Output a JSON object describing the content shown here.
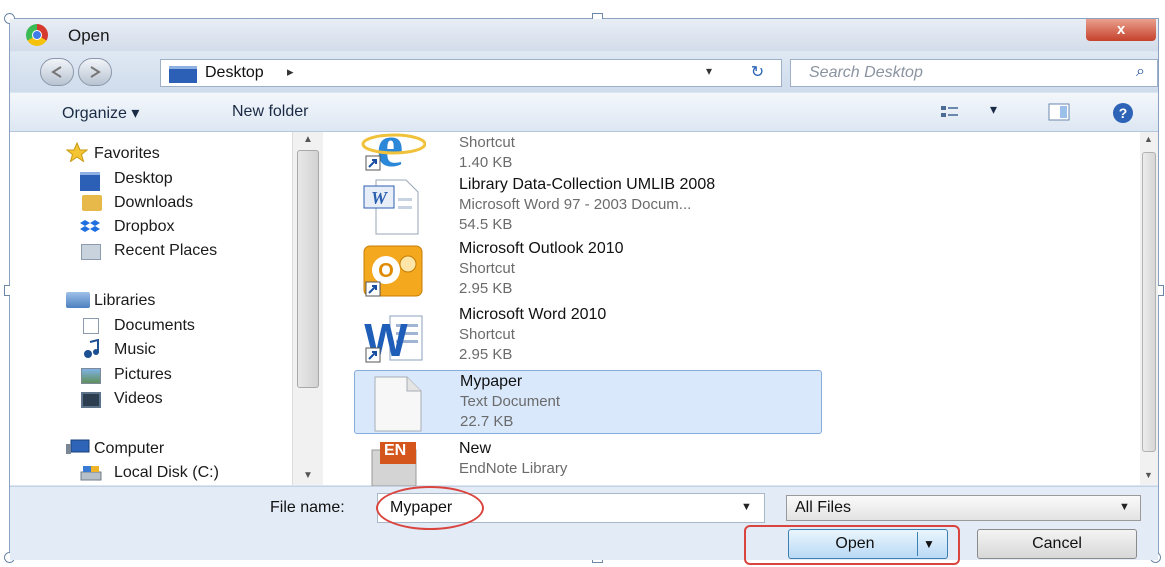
{
  "window": {
    "title": "Open",
    "close_glyph": "x"
  },
  "nav": {
    "back_icon": "back-arrow-icon",
    "forward_icon": "forward-arrow-icon",
    "address_label": "Desktop",
    "address_arrow": "▸",
    "address_dropdown": "▾",
    "refresh_glyph": "↻",
    "search_placeholder": "Search Desktop",
    "search_icon": "⌕"
  },
  "toolbar": {
    "organize": "Organize ▾",
    "new_folder": "New folder",
    "view_dd": "▾"
  },
  "sidebar": {
    "favorites_header": "Favorites",
    "favorites": [
      "Desktop",
      "Downloads",
      "Dropbox",
      "Recent Places"
    ],
    "libraries_header": "Libraries",
    "libraries": [
      "Documents",
      "Music",
      "Pictures",
      "Videos"
    ],
    "computer_header": "Computer",
    "computer": [
      "Local Disk (C:)"
    ]
  },
  "files": [
    {
      "name": "",
      "type": "Shortcut",
      "size": "1.40 KB",
      "icon": "internet-explorer-icon"
    },
    {
      "name": "Library Data-Collection UMLIB 2008",
      "type": "Microsoft Word 97 - 2003 Docum...",
      "size": "54.5 KB",
      "icon": "word-doc-icon"
    },
    {
      "name": "Microsoft Outlook 2010",
      "type": "Shortcut",
      "size": "2.95 KB",
      "icon": "outlook-icon"
    },
    {
      "name": "Microsoft Word 2010",
      "type": "Shortcut",
      "size": "2.95 KB",
      "icon": "word-icon"
    },
    {
      "name": "Mypaper",
      "type": "Text Document",
      "size": "22.7 KB",
      "icon": "text-file-icon",
      "selected": true
    },
    {
      "name": "New",
      "type": "EndNote Library",
      "size": "",
      "icon": "endnote-icon"
    }
  ],
  "footer": {
    "file_name_label": "File name:",
    "file_name_value": "Mypaper",
    "filter_value": "All Files",
    "open_label": "Open",
    "cancel_label": "Cancel",
    "endnote_badge": "EN"
  },
  "colors": {
    "selection": "#d9e8fb",
    "annotation_red": "#d9443f",
    "accent": "#2c5fb6"
  }
}
